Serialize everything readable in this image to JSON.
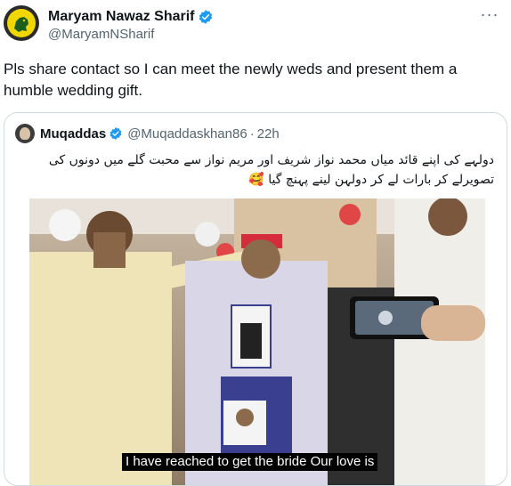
{
  "tweet": {
    "author_name": "Maryam Nawaz Sharif",
    "author_handle": "@MaryamNSharif",
    "text": "Pls share contact so I can meet the newly weds and present them a humble wedding gift.",
    "more_label": "···"
  },
  "quoted_tweet": {
    "author_name": "Muqaddas",
    "author_handle": "@Muqaddaskhan86",
    "separator": "·",
    "time": "22h",
    "text": "دولہے کی اپنے قائد میاں محمد نواز شریف اور مریم نواز سے محبت گلے میں دونوں کی تصویرلے کر بارات لے کر دولہن لینے پہنچ گیا 🥰",
    "video": {
      "caption": "I have reached to get the bride Our love is"
    }
  },
  "colors": {
    "verified_blue": "#1d9bf0",
    "secondary_text": "#536471",
    "border": "#cfd9de"
  },
  "icons": {
    "verified": "verified-badge-icon",
    "more": "more-icon"
  }
}
